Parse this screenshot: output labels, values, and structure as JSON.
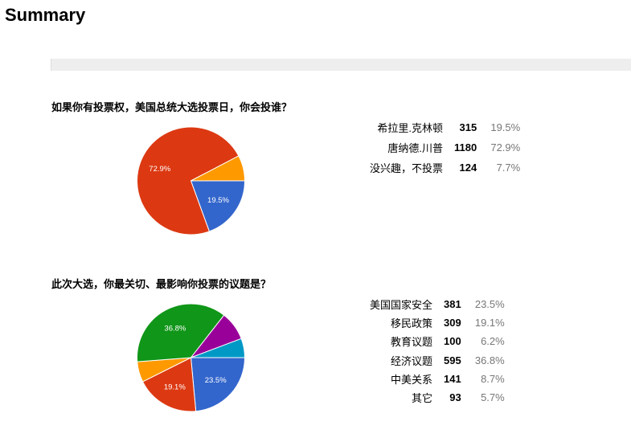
{
  "page": {
    "title": "Summary"
  },
  "questions": [
    {
      "title": "如果你有投票权，美国总统大选投票日，你会投谁？",
      "rows": [
        {
          "label": "希拉里.克林顿",
          "count": "315",
          "percent": "19.5%"
        },
        {
          "label": "唐纳德.川普",
          "count": "1180",
          "percent": "72.9%"
        },
        {
          "label": "没兴趣，不投票",
          "count": "124",
          "percent": "7.7%"
        }
      ]
    },
    {
      "title": "此次大选，你最关切、最影响你投票的议题是？",
      "rows": [
        {
          "label": "美国国家安全",
          "count": "381",
          "percent": "23.5%"
        },
        {
          "label": "移民政策",
          "count": "309",
          "percent": "19.1%"
        },
        {
          "label": "教育议题",
          "count": "100",
          "percent": "6.2%"
        },
        {
          "label": "经济议题",
          "count": "595",
          "percent": "36.8%"
        },
        {
          "label": "中美关系",
          "count": "141",
          "percent": "8.7%"
        },
        {
          "label": "其它",
          "count": "93",
          "percent": "5.7%"
        }
      ]
    }
  ],
  "chart_data": [
    {
      "type": "pie",
      "title": "如果你有投票权，美国总统大选投票日，你会投谁？",
      "categories": [
        "希拉里.克林顿",
        "唐纳德.川普",
        "没兴趣，不投票"
      ],
      "values": [
        315,
        1180,
        124
      ],
      "percents": [
        19.5,
        72.9,
        7.7
      ],
      "slice_labels": [
        "19.5%",
        "72.9%",
        ""
      ],
      "colors": [
        "#3366cc",
        "#dc3912",
        "#ff9900"
      ],
      "start": "3 o'clock, clockwise"
    },
    {
      "type": "pie",
      "title": "此次大选，你最关切、最影响你投票的议题是？",
      "categories": [
        "美国国家安全",
        "移民政策",
        "教育议题",
        "经济议题",
        "中美关系",
        "其它"
      ],
      "values": [
        381,
        309,
        100,
        595,
        141,
        93
      ],
      "percents": [
        23.5,
        19.1,
        6.2,
        36.8,
        8.7,
        5.7
      ],
      "slice_labels": [
        "23.5%",
        "19.1%",
        "",
        "36.8%",
        "",
        ""
      ],
      "colors": [
        "#3366cc",
        "#dc3912",
        "#ff9900",
        "#109618",
        "#990099",
        "#0099c6"
      ],
      "start": "3 o'clock, clockwise"
    }
  ]
}
